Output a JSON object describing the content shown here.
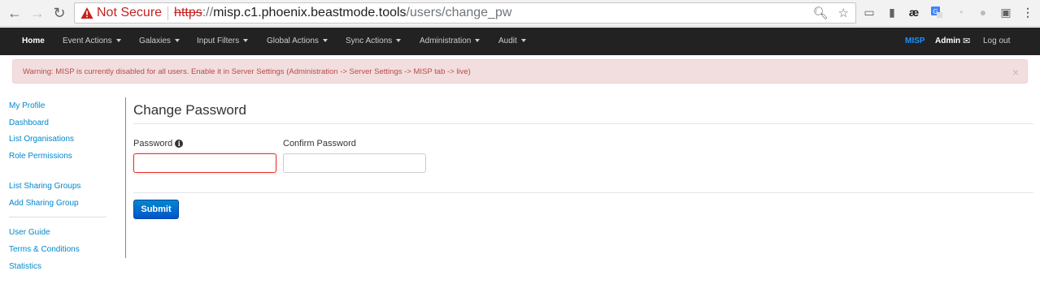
{
  "browser": {
    "security_label": "Not Secure",
    "url_scheme": "https",
    "url_sep": "://",
    "url_host": "misp.c1.phoenix.beastmode.tools",
    "url_path": "/users/change_pw"
  },
  "navbar": {
    "home": "Home",
    "items": [
      "Event Actions",
      "Galaxies",
      "Input Filters",
      "Global Actions",
      "Sync Actions",
      "Administration",
      "Audit"
    ],
    "brand": "MISP",
    "user": "Admin",
    "logout": "Log out"
  },
  "alert": {
    "text": "Warning: MISP is currently disabled for all users. Enable it in Server Settings (Administration -> Server Settings -> MISP tab -> live)",
    "close": "×"
  },
  "sidebar": {
    "items": [
      "My Profile",
      "Dashboard",
      "List Organisations",
      "Role Permissions",
      "List Sharing Groups",
      "Add Sharing Group",
      "User Guide",
      "Terms & Conditions",
      "Statistics"
    ]
  },
  "form": {
    "title": "Change Password",
    "password_label": "Password",
    "confirm_label": "Confirm Password",
    "password_value": "",
    "confirm_value": "",
    "submit_label": "Submit"
  },
  "colors": {
    "navbar_bg": "#222222",
    "brand": "#1e90ff",
    "alert_bg": "#f2dede",
    "alert_text": "#b94a48",
    "link": "#0088cc",
    "submit": "#0066cc"
  }
}
